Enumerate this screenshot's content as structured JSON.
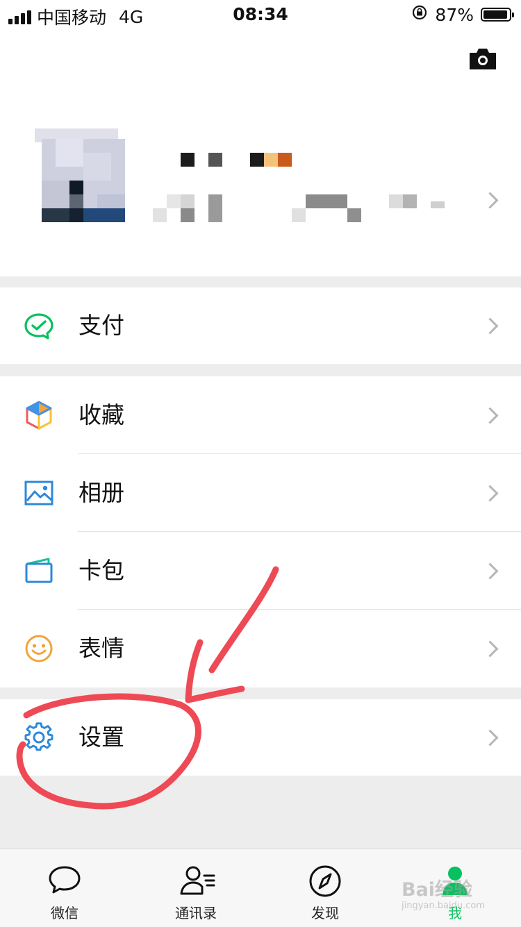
{
  "status_bar": {
    "carrier": "中国移动",
    "network": "4G",
    "time": "08:34",
    "battery": "87%",
    "battery_level": 0.87
  },
  "profile": {
    "camera_icon": "camera-icon",
    "arrow_icon": "chevron-right-icon"
  },
  "menu": {
    "pay": {
      "label": "支付",
      "icon": "wechat-pay-icon"
    },
    "favorites": {
      "label": "收藏",
      "icon": "cube-icon"
    },
    "album": {
      "label": "相册",
      "icon": "image-icon"
    },
    "cards": {
      "label": "卡包",
      "icon": "card-wallet-icon"
    },
    "stickers": {
      "label": "表情",
      "icon": "smiley-icon"
    },
    "settings": {
      "label": "设置",
      "icon": "gear-icon"
    }
  },
  "tabbar": {
    "chats": "微信",
    "contacts": "通讯录",
    "discover": "发现",
    "me": "我"
  },
  "watermark": {
    "line1": "Bai经验",
    "line2": "jingyan.baidu.com"
  },
  "colors": {
    "brand_green": "#07c160",
    "annotation_red": "#ee4a55",
    "icon_blue": "#2d88d9",
    "icon_orange": "#f0a43a"
  }
}
